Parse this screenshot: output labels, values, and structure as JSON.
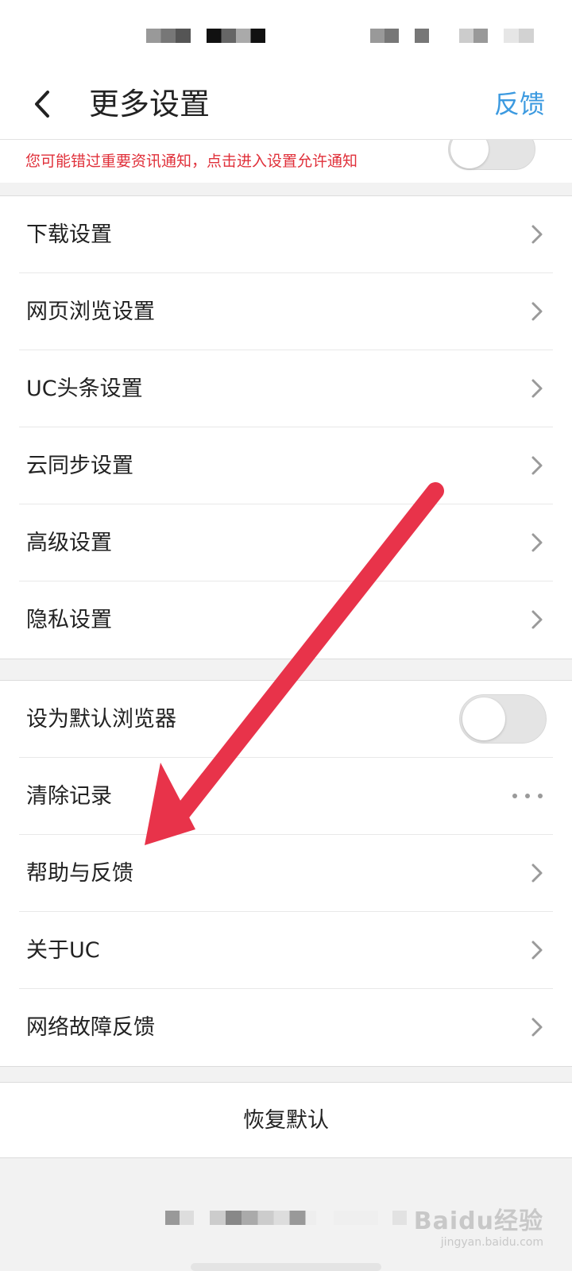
{
  "header": {
    "title": "更多设置",
    "feedback_label": "反馈"
  },
  "notification": {
    "warning_text": "您可能错过重要资讯通知，点击进入设置允许通知"
  },
  "groups": [
    {
      "items": [
        {
          "label": "下载设置",
          "control": "chevron"
        },
        {
          "label": "网页浏览设置",
          "control": "chevron"
        },
        {
          "label": "UC头条设置",
          "control": "chevron"
        },
        {
          "label": "云同步设置",
          "control": "chevron"
        },
        {
          "label": "高级设置",
          "control": "chevron"
        },
        {
          "label": "隐私设置",
          "control": "chevron"
        }
      ]
    },
    {
      "items": [
        {
          "label": "设为默认浏览器",
          "control": "toggle",
          "checked": false
        },
        {
          "label": "清除记录",
          "control": "more-dots"
        },
        {
          "label": "帮助与反馈",
          "control": "chevron"
        },
        {
          "label": "关于UC",
          "control": "chevron"
        },
        {
          "label": "网络故障反馈",
          "control": "chevron"
        }
      ]
    }
  ],
  "restore_button_label": "恢复默认",
  "annotation": {
    "arrow_color": "#e8334a",
    "points_to": "帮助与反馈"
  },
  "colors": {
    "accent": "#3c9ae0",
    "warning": "#e0303a"
  },
  "watermark": {
    "brand": "Baidu经验",
    "url": "jingyan.baidu.com"
  }
}
